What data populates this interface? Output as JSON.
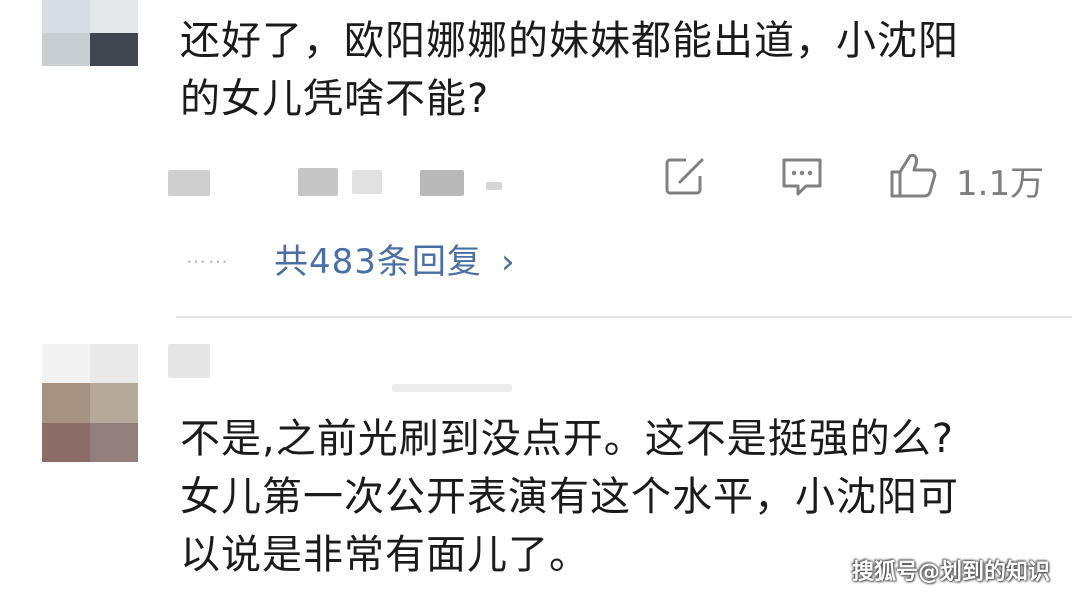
{
  "comment1": {
    "text_line1": "还好了，欧阳娜娜的妹妹都能出道，小沈阳",
    "text_line2": "的女儿凭啥不能?",
    "actions": {
      "share_icon": "edit-square-icon",
      "reply_icon": "comment-bubble-icon",
      "like_icon": "thumbs-up-icon",
      "like_count": "1.1万"
    },
    "replies": {
      "dots": "……",
      "label": "共483条回复",
      "chevron": "›"
    }
  },
  "comment2": {
    "text_line1": "不是,之前光刷到没点开。这不是挺强的么?",
    "text_line2": "女儿第一次公开表演有这个水平，小沈阳可",
    "text_line3": "以说是非常有面儿了。"
  },
  "watermark": {
    "text": "搜狐号@划到的知识"
  },
  "colors": {
    "link": "#4a6fa5",
    "muted": "#7d7d7d",
    "text": "#1b1b1b"
  }
}
